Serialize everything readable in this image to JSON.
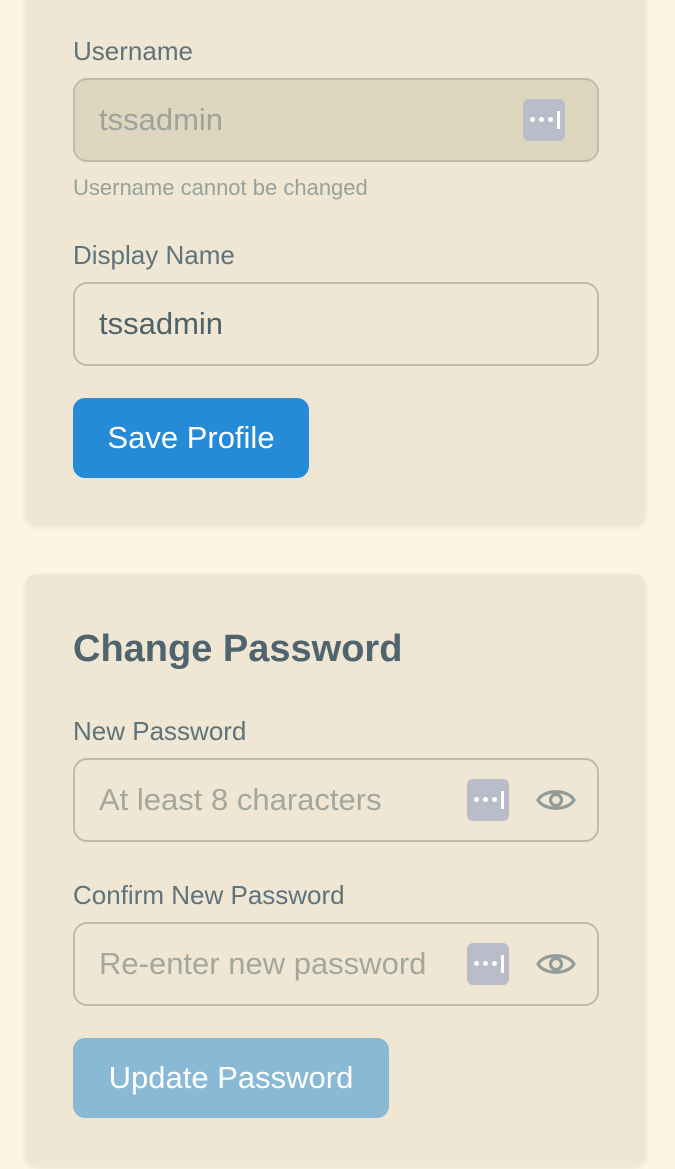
{
  "profile": {
    "username_label": "Username",
    "username_value": "tssadmin",
    "username_hint": "Username cannot be changed",
    "display_name_label": "Display Name",
    "display_name_value": "tssadmin",
    "save_label": "Save Profile"
  },
  "password": {
    "title": "Change Password",
    "new_label": "New Password",
    "new_placeholder": "At least 8 characters",
    "confirm_label": "Confirm New Password",
    "confirm_placeholder": "Re-enter new password",
    "update_label": "Update Password"
  },
  "icons": {
    "password_manager": "password-manager-icon",
    "show_password": "eye-icon"
  },
  "colors": {
    "page_background": "#fcf5e3",
    "card_background": "#efe7d4",
    "primary_button": "#268bd6",
    "disabled_button": "#8ab9d5"
  }
}
